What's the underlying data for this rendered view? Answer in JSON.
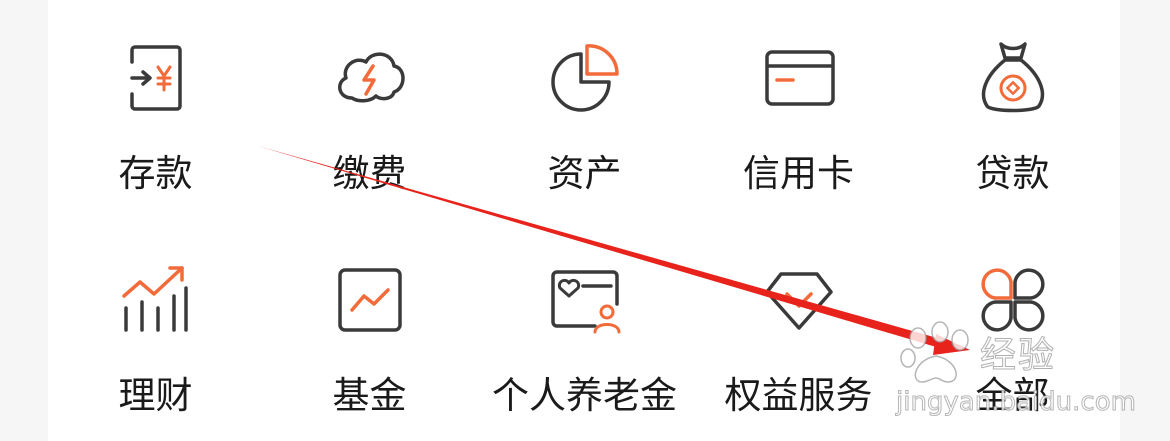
{
  "colors": {
    "icon_dark": "#3a3a3a",
    "icon_accent": "#f26b3a",
    "label": "#1a1a1a",
    "arrow": "#e8231c"
  },
  "menu": {
    "row1": [
      {
        "label": "存款",
        "icon": "deposit-icon"
      },
      {
        "label": "缴费",
        "icon": "payment-icon"
      },
      {
        "label": "资产",
        "icon": "assets-icon"
      },
      {
        "label": "信用卡",
        "icon": "credit-card-icon"
      },
      {
        "label": "贷款",
        "icon": "loan-icon"
      }
    ],
    "row2": [
      {
        "label": "理财",
        "icon": "wealth-icon"
      },
      {
        "label": "基金",
        "icon": "fund-icon"
      },
      {
        "label": "个人养老金",
        "icon": "pension-icon"
      },
      {
        "label": "权益服务",
        "icon": "diamond-icon"
      },
      {
        "label": "全部",
        "icon": "all-icon"
      }
    ]
  },
  "watermark": {
    "brand": "经验",
    "url": "jingyan.baidu.com"
  }
}
